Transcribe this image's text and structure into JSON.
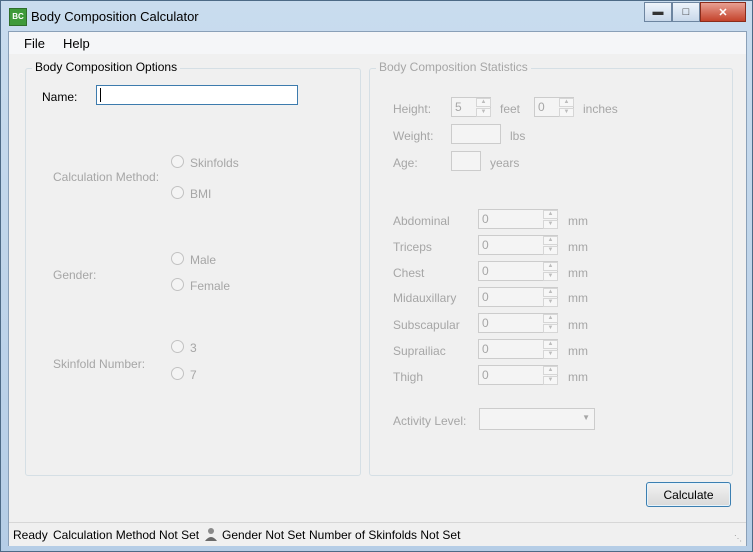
{
  "window": {
    "title": "Body Composition Calculator",
    "icon_text": "BC"
  },
  "menu": {
    "file": "File",
    "help": "Help"
  },
  "options": {
    "title": "Body Composition Options",
    "name_label": "Name:",
    "name_value": "",
    "calc_label": "Calculation Method:",
    "calc_options": [
      "Skinfolds",
      "BMI"
    ],
    "gender_label": "Gender:",
    "gender_options": [
      "Male",
      "Female"
    ],
    "skinfold_label": "Skinfold Number:",
    "skinfold_options": [
      "3",
      "7"
    ]
  },
  "stats": {
    "title": "Body Composition Statistics",
    "height_label": "Height:",
    "height_feet": "5",
    "feet_unit": "feet",
    "height_inches": "0",
    "inches_unit": "inches",
    "weight_label": "Weight:",
    "weight_unit": "lbs",
    "age_label": "Age:",
    "age_unit": "years",
    "measurements": [
      {
        "label": "Abdominal",
        "value": "0",
        "unit": "mm"
      },
      {
        "label": "Triceps",
        "value": "0",
        "unit": "mm"
      },
      {
        "label": "Chest",
        "value": "0",
        "unit": "mm"
      },
      {
        "label": "Midauxillary",
        "value": "0",
        "unit": "mm"
      },
      {
        "label": "Subscapular",
        "value": "0",
        "unit": "mm"
      },
      {
        "label": "Suprailiac",
        "value": "0",
        "unit": "mm"
      },
      {
        "label": "Thigh",
        "value": "0",
        "unit": "mm"
      }
    ],
    "activity_label": "Activity Level:",
    "activity_value": ""
  },
  "calculate_label": "Calculate",
  "status": {
    "ready": "Ready",
    "calc": "Calculation Method Not Set",
    "gender": "Gender Not Set",
    "skinfolds": "Number of Skinfolds Not Set"
  }
}
